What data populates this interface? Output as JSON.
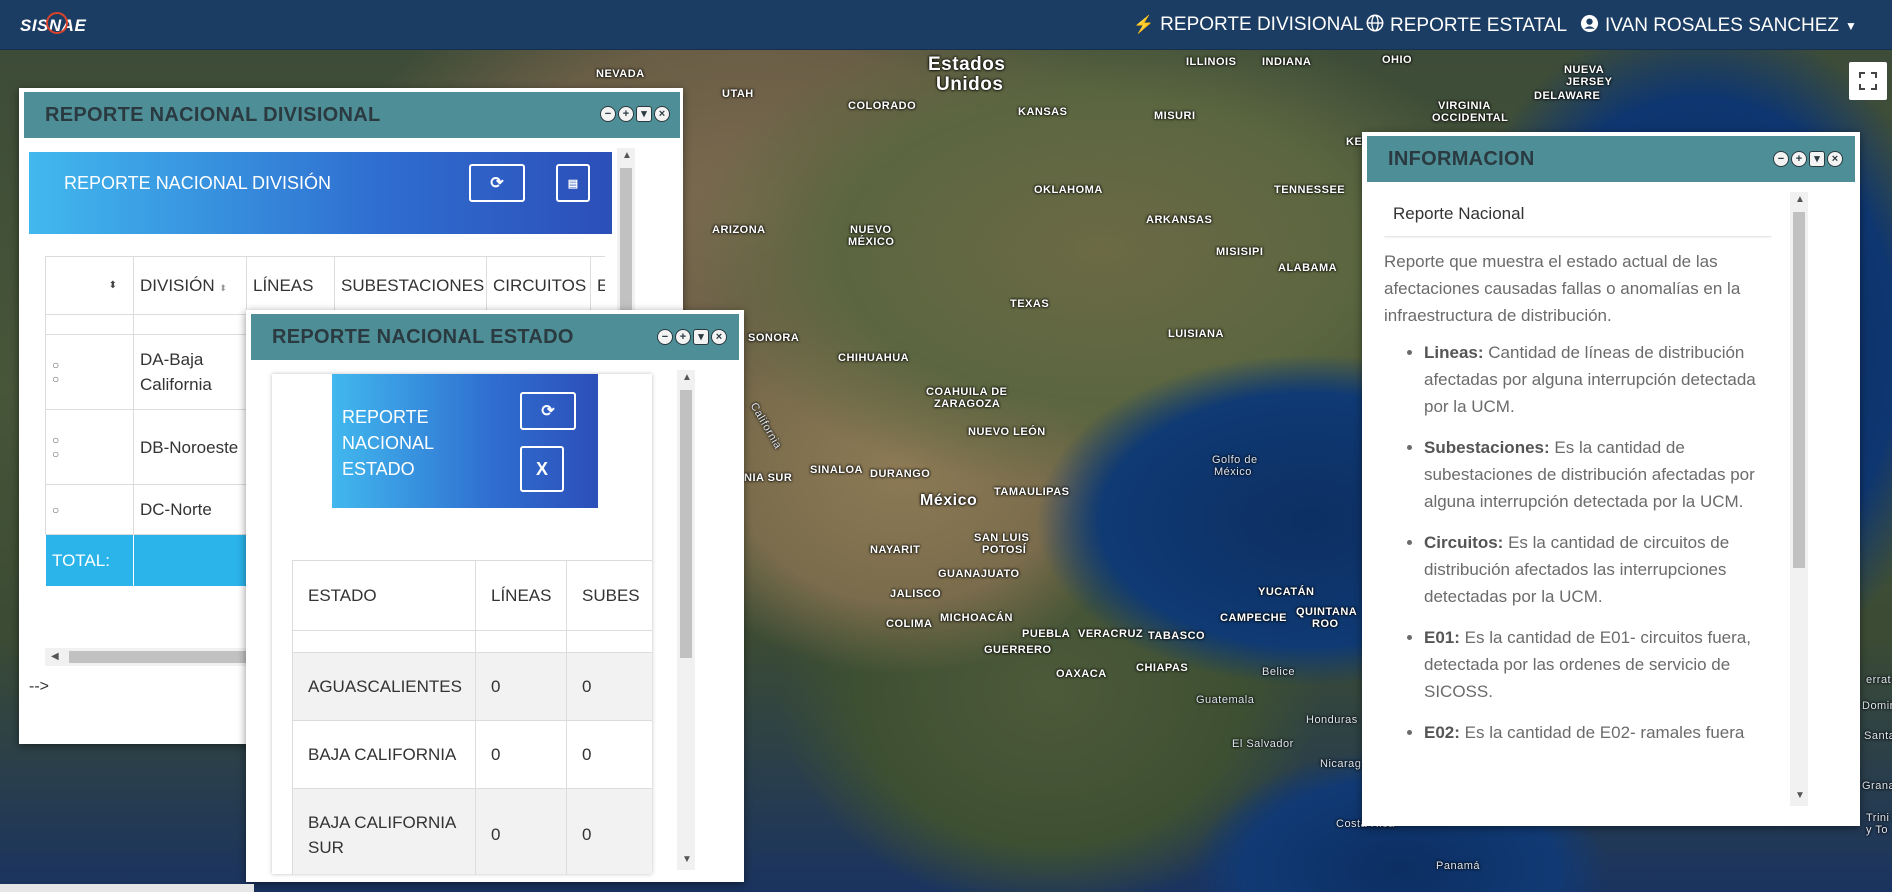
{
  "navbar": {
    "brand": "SISNAE",
    "items": [
      {
        "label": "REPORTE DIVISIONAL",
        "icon": "bolt-icon"
      },
      {
        "label": "REPORTE ESTATAL",
        "icon": "globe-icon"
      },
      {
        "label": "IVAN ROSALES SANCHEZ",
        "icon": "user-circle-icon"
      }
    ]
  },
  "map": {
    "labels": [
      "Estados",
      "Unidos",
      "NEVADA",
      "UTAH",
      "COLORADO",
      "KANSAS",
      "MISURI",
      "ILLINOIS",
      "INDIANA",
      "OHIO",
      "NUEVA",
      "JERSEY",
      "DELAWARE",
      "VIRGINIA",
      "OCCIDENTAL",
      "KENTU",
      "TENNESSEE",
      "OKLAHOMA",
      "ARKANSAS",
      "ARIZONA",
      "NUEVO",
      "MÉXICO",
      "MISISIPI",
      "ALABAMA",
      "TEXAS",
      "LUISIANA",
      "SONORA",
      "CHIHUAHUA",
      "COAHUILA DE",
      "ZARAGOZA",
      "NUEVO LEÓN",
      "SINALOA",
      "DURANGO",
      "México",
      "TAMAULIPAS",
      "SAN LUIS",
      "POTOSÍ",
      "NAYARIT",
      "GUANAJUATO",
      "JALISCO",
      "COLIMA",
      "MICHOACÁN",
      "PUEBLA",
      "VERACRUZ",
      "TABASCO",
      "YUCATÁN",
      "CAMPECHE",
      "QUINTANA",
      "ROO",
      "GUERRERO",
      "OAXACA",
      "CHIAPAS",
      "Belice",
      "Guatemala",
      "Honduras",
      "El Salvador",
      "Nicarag",
      "Costa Rica",
      "Panamá",
      "Golfo de",
      "México",
      "California",
      "NIA SUR",
      "errat",
      "Domin",
      "Santa",
      "Grana",
      "Trini",
      "y To"
    ]
  },
  "divisional": {
    "title": "REPORTE NACIONAL DIVISIONAL",
    "card_title": "REPORTE NACIONAL DIVISIÓN",
    "columns": [
      "",
      "DIVISIÓN",
      "LÍNEAS",
      "SUBESTACIONES",
      "CIRCUITOS",
      "E"
    ],
    "rows": [
      {
        "name": "DA-Baja California"
      },
      {
        "name": "DB-Noroeste"
      },
      {
        "name": "DC-Norte"
      }
    ],
    "total_label": "TOTAL:",
    "comment_text": "-->"
  },
  "estado": {
    "title": "REPORTE NACIONAL ESTADO",
    "card_title": "REPORTE NACIONAL ESTADO",
    "columns": [
      "ESTADO",
      "LÍNEAS",
      "SUBES"
    ],
    "rows": [
      {
        "estado": "AGUASCALIENTES",
        "lineas": "0",
        "subes": "0"
      },
      {
        "estado": "BAJA CALIFORNIA",
        "lineas": "0",
        "subes": "0"
      },
      {
        "estado": "BAJA CALIFORNIA SUR",
        "lineas": "0",
        "subes": "0"
      }
    ]
  },
  "informacion": {
    "title": "INFORMACION",
    "subtitle": "Reporte Nacional",
    "intro": "Reporte que muestra el estado actual de las afectaciones causadas fallas o anomalías en la infraestructura de distribución.",
    "items": [
      {
        "term": "Lineas:",
        "text": "Cantidad de líneas de distribución afectadas por alguna interrupción detectada por la UCM."
      },
      {
        "term": "Subestaciones:",
        "text": "Es la cantidad de subestaciones de distribución afectadas por alguna interrupción detectada por la UCM."
      },
      {
        "term": "Circuitos:",
        "text": "Es la cantidad de circuitos de distribución afectados las interrupciones detectadas por la UCM."
      },
      {
        "term": "E01:",
        "text": "Es la cantidad de E01- circuitos fuera, detectada por las ordenes de servicio de SICOSS."
      },
      {
        "term": "E02:",
        "text": "Es la cantidad de E02- ramales fuera"
      }
    ]
  }
}
